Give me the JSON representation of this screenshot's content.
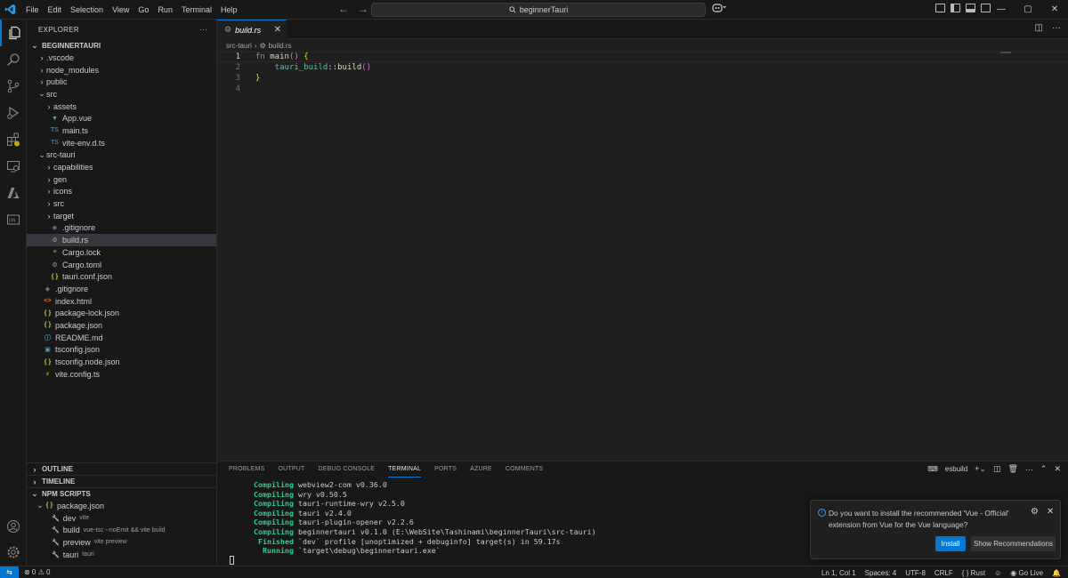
{
  "titlebar": {
    "menu": [
      "File",
      "Edit",
      "Selection",
      "View",
      "Go",
      "Run",
      "Terminal",
      "Help"
    ],
    "search_text": "beginnerTauri",
    "nav_back": "←",
    "nav_forward": "→",
    "window_controls": [
      "—",
      "▢",
      "✕"
    ]
  },
  "explorer": {
    "title": "EXPLORER",
    "more": "···",
    "root": "BEGINNERTAURI",
    "tree": [
      {
        "label": ".vscode",
        "type": "folder",
        "open": false,
        "depth": 1
      },
      {
        "label": "node_modules",
        "type": "folder",
        "open": false,
        "depth": 1
      },
      {
        "label": "public",
        "type": "folder",
        "open": false,
        "depth": 1
      },
      {
        "label": "src",
        "type": "folder",
        "open": true,
        "depth": 1
      },
      {
        "label": "assets",
        "type": "folder",
        "open": false,
        "depth": 2
      },
      {
        "label": "App.vue",
        "type": "vue",
        "depth": 2
      },
      {
        "label": "main.ts",
        "type": "ts",
        "depth": 2
      },
      {
        "label": "vite-env.d.ts",
        "type": "ts",
        "depth": 2
      },
      {
        "label": "src-tauri",
        "type": "folder",
        "open": true,
        "depth": 1
      },
      {
        "label": "capabilities",
        "type": "folder",
        "open": false,
        "depth": 2
      },
      {
        "label": "gen",
        "type": "folder",
        "open": false,
        "depth": 2
      },
      {
        "label": "icons",
        "type": "folder",
        "open": false,
        "depth": 2
      },
      {
        "label": "src",
        "type": "folder",
        "open": false,
        "depth": 2
      },
      {
        "label": "target",
        "type": "folder",
        "open": false,
        "depth": 2
      },
      {
        "label": ".gitignore",
        "type": "git",
        "depth": 2
      },
      {
        "label": "build.rs",
        "type": "rust",
        "depth": 2,
        "selected": true
      },
      {
        "label": "Cargo.lock",
        "type": "lock",
        "depth": 2
      },
      {
        "label": "Cargo.toml",
        "type": "toml",
        "depth": 2
      },
      {
        "label": "tauri.conf.json",
        "type": "json",
        "depth": 2
      },
      {
        "label": ".gitignore",
        "type": "git",
        "depth": 1
      },
      {
        "label": "index.html",
        "type": "html",
        "depth": 1
      },
      {
        "label": "package-lock.json",
        "type": "json",
        "depth": 1
      },
      {
        "label": "package.json",
        "type": "json",
        "depth": 1
      },
      {
        "label": "README.md",
        "type": "md",
        "depth": 1
      },
      {
        "label": "tsconfig.json",
        "type": "tsconfig",
        "depth": 1
      },
      {
        "label": "tsconfig.node.json",
        "type": "json",
        "depth": 1
      },
      {
        "label": "vite.config.ts",
        "type": "vite",
        "depth": 1
      }
    ],
    "outline": "OUTLINE",
    "timeline": "TIMELINE",
    "npm_scripts": "NPM SCRIPTS",
    "npm_package": "package.json",
    "npm": [
      {
        "name": "dev",
        "cmd": "vite"
      },
      {
        "name": "build",
        "cmd": "vue-tsc --noEmit && vite build"
      },
      {
        "name": "preview",
        "cmd": "vite preview"
      },
      {
        "name": "tauri",
        "cmd": "tauri"
      }
    ]
  },
  "editor": {
    "tab_label": "build.rs",
    "tab_close": "✕",
    "breadcrumb": [
      "src-tauri",
      "build.rs"
    ],
    "line_numbers": [
      "1",
      "2",
      "3",
      "4"
    ],
    "code": {
      "l1_kw": "fn",
      "l1_name": "main",
      "l1_paren": "()",
      "l1_brace": "{",
      "l2_ident": "tauri_build",
      "l2_sep": "::",
      "l2_name": "build",
      "l2_paren": "()",
      "l3_brace": "}"
    }
  },
  "panel": {
    "tabs": [
      "PROBLEMS",
      "OUTPUT",
      "DEBUG CONSOLE",
      "TERMINAL",
      "PORTS",
      "AZURE",
      "COMMENTS"
    ],
    "active_tab": "TERMINAL",
    "terminal_name": "esbuild",
    "terminal": [
      {
        "kw": "   Compiling",
        "rest": " webview2-com v0.36.0"
      },
      {
        "kw": "   Compiling",
        "rest": " wry v0.50.5"
      },
      {
        "kw": "   Compiling",
        "rest": " tauri-runtime-wry v2.5.0"
      },
      {
        "kw": "   Compiling",
        "rest": " tauri v2.4.0"
      },
      {
        "kw": "   Compiling",
        "rest": " tauri-plugin-opener v2.2.6"
      },
      {
        "kw": "   Compiling",
        "rest": " beginnertauri v0.1.0 (E:\\WebSite\\Tashinami\\beginnerTauri\\src-tauri)"
      },
      {
        "kw": "    Finished",
        "rest": " `dev` profile [unoptimized + debuginfo] target(s) in 59.17s"
      },
      {
        "kw": "     Running",
        "rest": " `target\\debug\\beginnertauri.exe`"
      }
    ]
  },
  "notification": {
    "message": "Do you want to install the recommended 'Vue - Official' extension from Vue for the Vue language?",
    "install": "Install",
    "show_recommendations": "Show Recommendations"
  },
  "statusbar": {
    "problems": "⊗ 0 ⚠ 0",
    "position": "Ln 1, Col 1",
    "spaces": "Spaces: 4",
    "encoding": "UTF-8",
    "eol": "CRLF",
    "language": "Rust",
    "golive": "Go Live"
  },
  "colors": {
    "accent": "#0078d4",
    "background": "#1f1f1f",
    "sidebar": "#181818"
  }
}
